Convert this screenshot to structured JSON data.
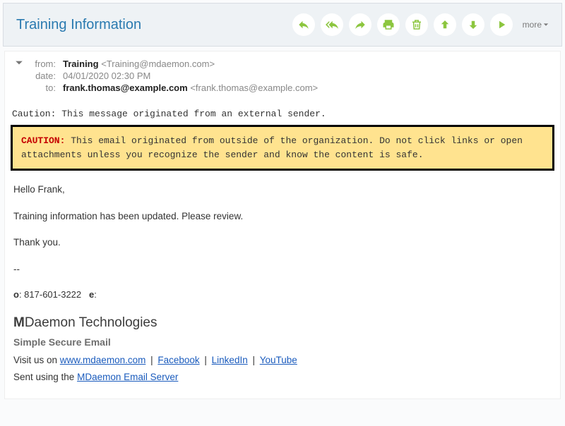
{
  "subject": "Training Information",
  "toolbar": {
    "more": "more"
  },
  "icons": {
    "reply": "reply-icon",
    "replyall": "reply-all-icon",
    "forward": "forward-icon",
    "print": "print-icon",
    "delete": "delete-icon",
    "up": "up-arrow-icon",
    "down": "down-arrow-icon",
    "play": "next-icon"
  },
  "headers": {
    "from_label": "from:",
    "from_name": "Training",
    "from_addr": "<Training@mdaemon.com>",
    "date_label": "date:",
    "date_value": "04/01/2020 02:30 PM",
    "to_label": "to:",
    "to_name": "frank.thomas@example.com",
    "to_addr": "<frank.thomas@example.com>"
  },
  "caution_line": "Caution: This message originated from an external sender.",
  "warn": {
    "prefix": "CAUTION:",
    "text": " This email originated from outside of the organization. Do not click links or open attachments unless you recognize the sender and know the content is safe."
  },
  "body": {
    "greeting": "Hello Frank,",
    "line1": "Training information has been updated. Please review.",
    "thanks": "Thank you.",
    "dash": "--"
  },
  "sig": {
    "o_label": "o",
    "o_val": ": 817-601-3222",
    "e_label": "e",
    "e_val": ":",
    "company_bold": "M",
    "company_rest": "Daemon Technologies",
    "tagline": "Simple Secure Email",
    "visit_prefix": "Visit us on ",
    "link1": "www.mdaemon.com",
    "link2": "Facebook",
    "link3": "LinkedIn",
    "link4": "YouTube",
    "sent_prefix": "Sent using the ",
    "sent_link": "MDaemon Email Server"
  }
}
